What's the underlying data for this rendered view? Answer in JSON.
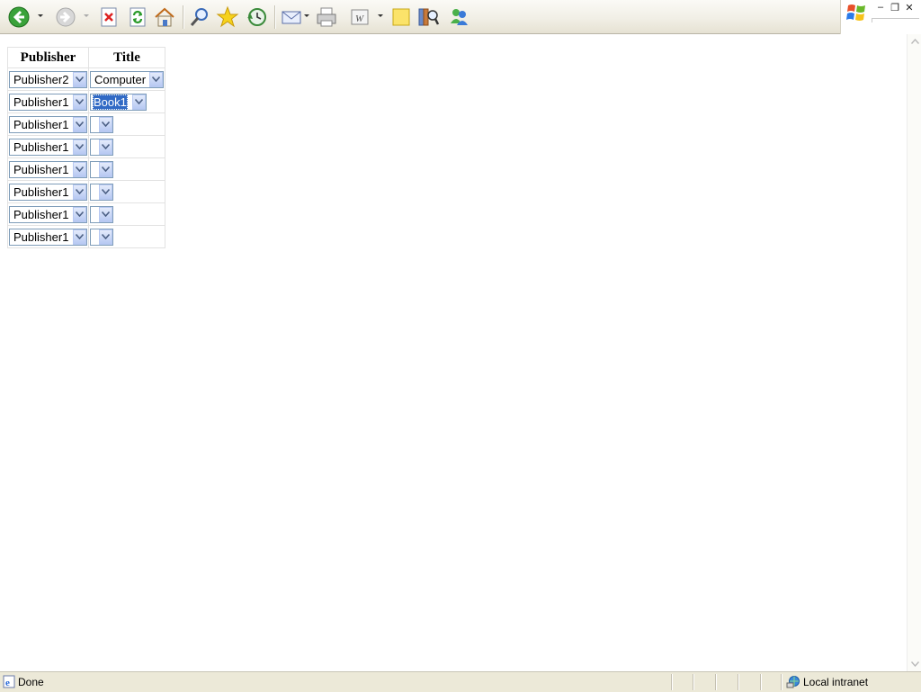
{
  "table": {
    "headers": {
      "publisher": "Publisher",
      "title": "Title"
    },
    "rows": [
      {
        "publisher": "Publisher2",
        "title": "Computer",
        "title_selected": false
      },
      {
        "publisher": "Publisher1",
        "title": "Book1",
        "title_selected": true
      },
      {
        "publisher": "Publisher1",
        "title": "",
        "title_selected": false
      },
      {
        "publisher": "Publisher1",
        "title": "",
        "title_selected": false
      },
      {
        "publisher": "Publisher1",
        "title": "",
        "title_selected": false
      },
      {
        "publisher": "Publisher1",
        "title": "",
        "title_selected": false
      },
      {
        "publisher": "Publisher1",
        "title": "",
        "title_selected": false
      },
      {
        "publisher": "Publisher1",
        "title": "",
        "title_selected": false
      }
    ]
  },
  "statusbar": {
    "status": "Done",
    "zone": "Local intranet"
  },
  "toolbar": {
    "icons": [
      "back-icon",
      "forward-icon",
      "stop-icon",
      "refresh-icon",
      "home-icon",
      "search-icon",
      "favorites-icon",
      "history-icon",
      "mail-icon",
      "print-icon",
      "word-edit-icon",
      "notes-icon",
      "research-icon",
      "messenger-icon"
    ]
  },
  "colors": {
    "selection": "#316ac5",
    "select_border": "#7f9db9"
  }
}
